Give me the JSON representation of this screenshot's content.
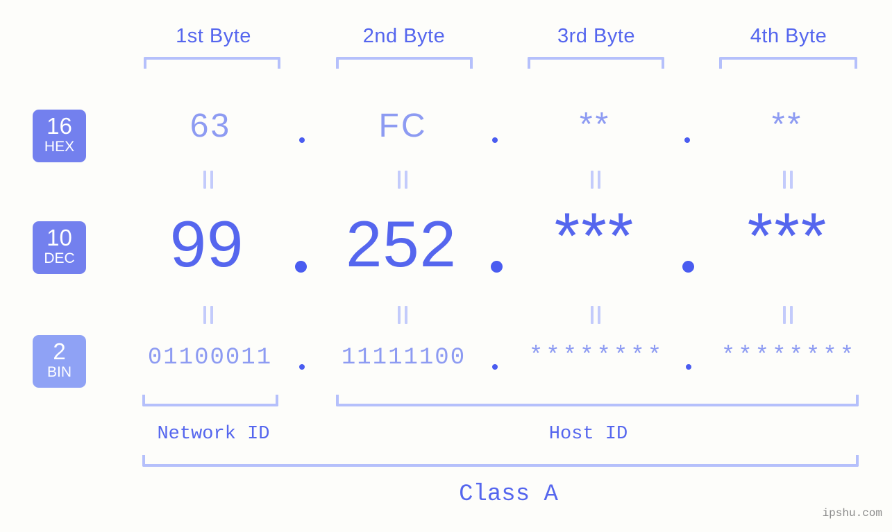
{
  "meta": {
    "watermark": "ipshu.com",
    "background_color": "#fdfdfa",
    "accent_strong": "#5566ee",
    "accent_light": "#8d9bf2",
    "bracket_color": "#b5c0fb",
    "badge_color": "#7380ee",
    "badge_color_bin": "#8fa2f5"
  },
  "headers": {
    "bytes": [
      {
        "label": "1st Byte"
      },
      {
        "label": "2nd Byte"
      },
      {
        "label": "3rd Byte"
      },
      {
        "label": "4th Byte"
      }
    ]
  },
  "rows": {
    "hex": {
      "badge_number": "16",
      "badge_name": "HEX",
      "values": [
        "63",
        "FC",
        "**",
        "**"
      ],
      "separator": "."
    },
    "dec": {
      "badge_number": "10",
      "badge_name": "DEC",
      "values": [
        "99",
        "252",
        "***",
        "***"
      ],
      "separator": "."
    },
    "bin": {
      "badge_number": "2",
      "badge_name": "BIN",
      "values": [
        "01100011",
        "11111100",
        "********",
        "********"
      ],
      "separator": "."
    }
  },
  "connectors": {
    "equals_symbol": "="
  },
  "footer": {
    "network_id_label": "Network ID",
    "host_id_label": "Host ID",
    "class_label": "Class A"
  }
}
